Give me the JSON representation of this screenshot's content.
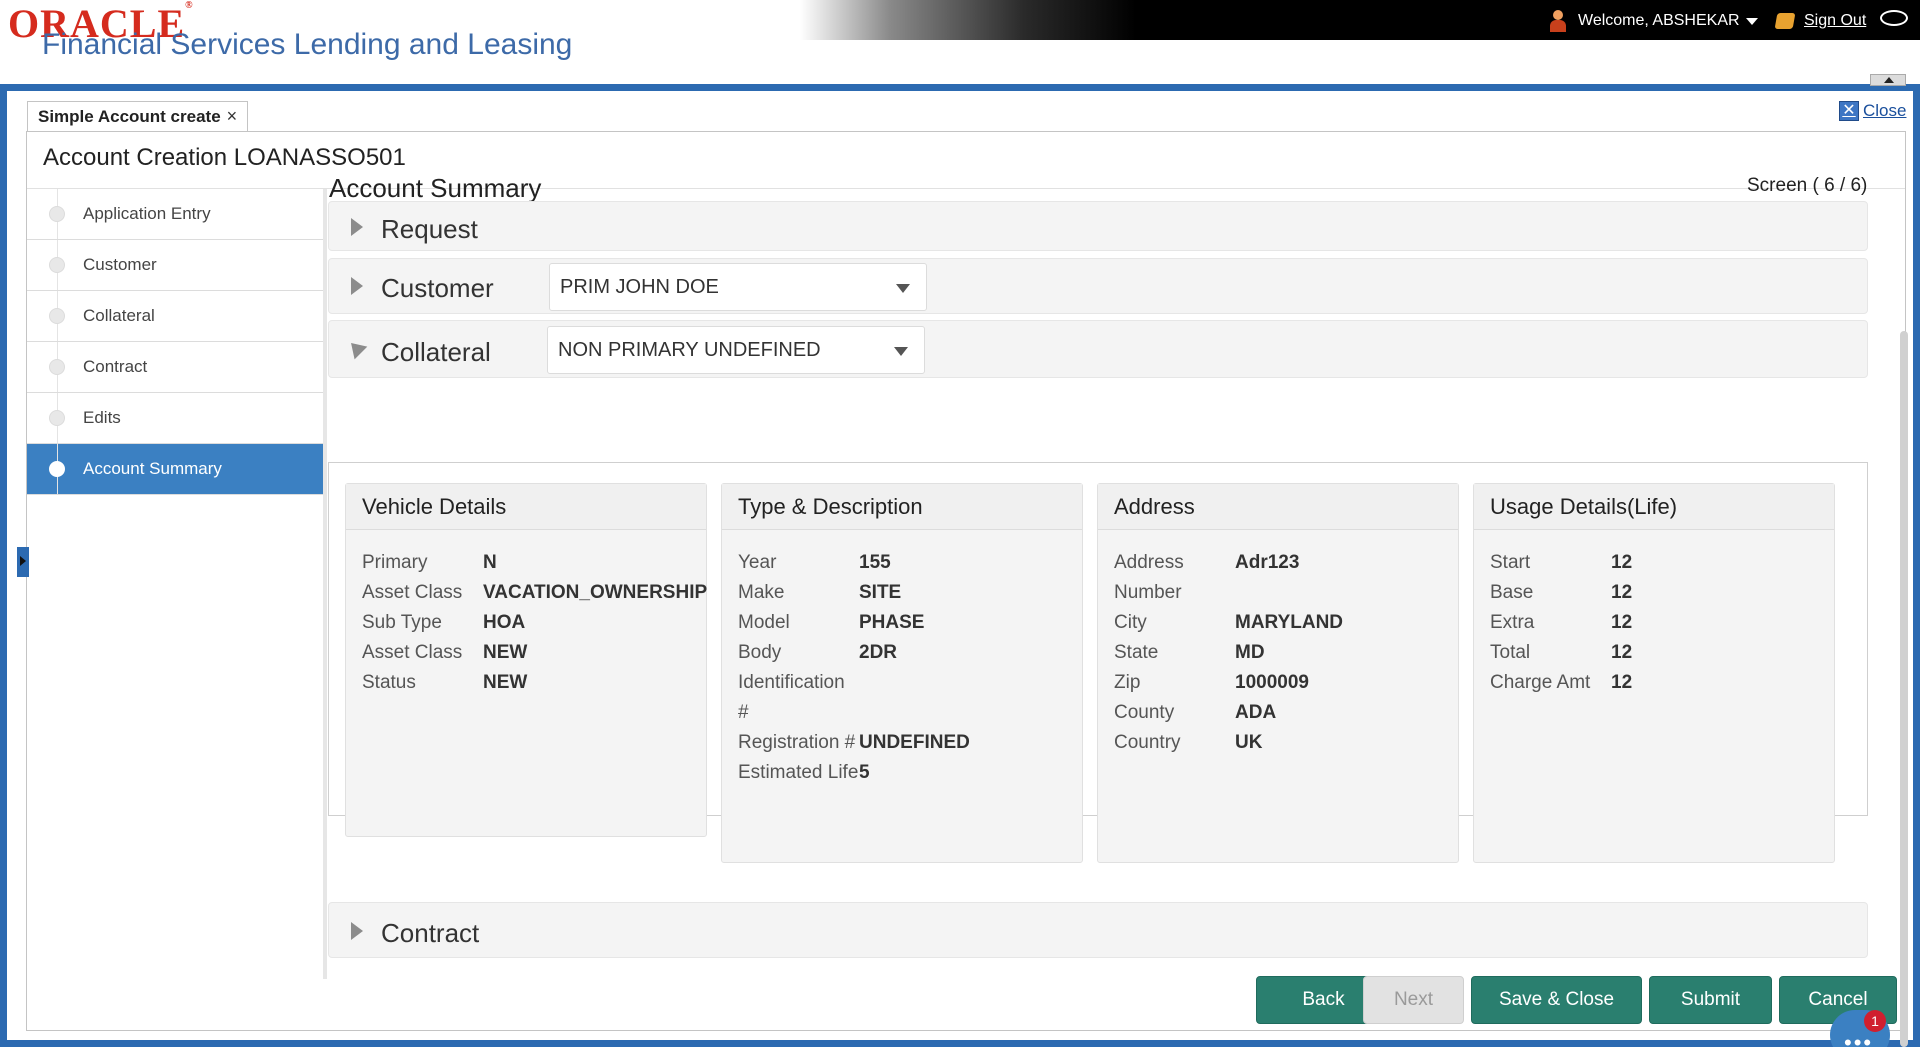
{
  "header": {
    "brand": "ORACLE",
    "brand_mark": "®",
    "product": "Financial Services Lending and Leasing",
    "welcome": "Welcome, ABSHEKAR",
    "sign_out": "Sign Out"
  },
  "tab": {
    "label": "Simple Account create",
    "close_glyph": "×"
  },
  "close_link": {
    "label": "Close",
    "icon": "close-icon"
  },
  "page": {
    "title": "Account Creation LOANASSO501"
  },
  "nav": {
    "items": [
      {
        "label": "Application Entry",
        "active": false
      },
      {
        "label": "Customer",
        "active": false
      },
      {
        "label": "Collateral",
        "active": false
      },
      {
        "label": "Contract",
        "active": false
      },
      {
        "label": "Edits",
        "active": false
      },
      {
        "label": "Account Summary",
        "active": true
      }
    ]
  },
  "main": {
    "title": "Account Summary",
    "screen": "Screen ( 6 / 6)",
    "panels": {
      "request": {
        "title": "Request"
      },
      "customer": {
        "title": "Customer",
        "selected": "PRIM JOHN DOE"
      },
      "collateral": {
        "title": "Collateral",
        "selected": "NON PRIMARY UNDEFINED"
      },
      "contract": {
        "title": "Contract"
      }
    },
    "cards": [
      {
        "title": "Vehicle Details",
        "rows": [
          {
            "label": "Primary",
            "value": "N"
          },
          {
            "label": "Asset Class",
            "value": "VACATION_OWNERSHIP"
          },
          {
            "label": "Sub Type",
            "value": "HOA"
          },
          {
            "label": "Asset Class",
            "value": "NEW"
          },
          {
            "label": "Status",
            "value": "NEW"
          }
        ]
      },
      {
        "title": "Type & Description",
        "rows": [
          {
            "label": "Year",
            "value": "155"
          },
          {
            "label": "Make",
            "value": "SITE"
          },
          {
            "label": "Model",
            "value": "PHASE"
          },
          {
            "label": "Body",
            "value": "2DR"
          },
          {
            "label": "Identification #",
            "value": ""
          },
          {
            "label": "Registration #",
            "value": "UNDEFINED"
          },
          {
            "label": "Estimated Life",
            "value": "5"
          }
        ]
      },
      {
        "title": "Address",
        "rows": [
          {
            "label": "Address Number",
            "value": "Adr123"
          },
          {
            "label": "City",
            "value": "MARYLAND"
          },
          {
            "label": "State",
            "value": "MD"
          },
          {
            "label": "Zip",
            "value": "1000009"
          },
          {
            "label": "County",
            "value": "ADA"
          },
          {
            "label": "Country",
            "value": "UK"
          }
        ]
      },
      {
        "title": "Usage Details(Life)",
        "rows": [
          {
            "label": "Start",
            "value": "12"
          },
          {
            "label": "Base",
            "value": "12"
          },
          {
            "label": "Extra",
            "value": "12"
          },
          {
            "label": "Total",
            "value": "12"
          },
          {
            "label": "Charge Amt",
            "value": "12"
          }
        ]
      }
    ]
  },
  "actions": {
    "back": "Back",
    "next": "Next",
    "save_close": "Save & Close",
    "submit": "Submit",
    "cancel": "Cancel"
  },
  "chat": {
    "badge": "1",
    "dots": "•••"
  },
  "colors": {
    "brand_red": "#d52b1e",
    "product_blue": "#3d6aa8",
    "frame_blue": "#2c6ab1",
    "nav_active": "#3b80c2",
    "button_green": "#2a7f6f"
  }
}
